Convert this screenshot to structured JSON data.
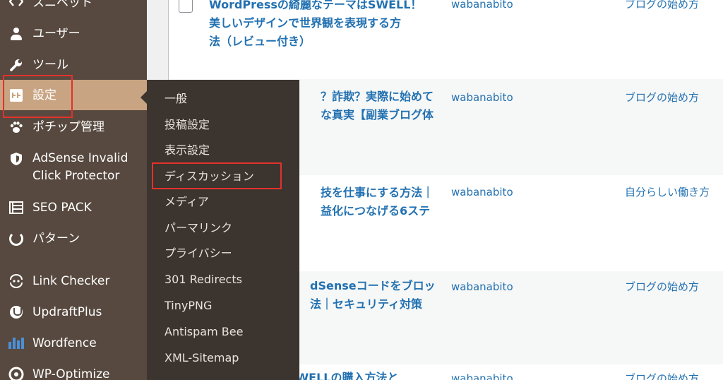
{
  "sidebar": {
    "items": [
      {
        "label": "スニペット",
        "icon": "snippet-icon"
      },
      {
        "label": "ユーザー",
        "icon": "user-icon"
      },
      {
        "label": "ツール",
        "icon": "wrench-icon"
      },
      {
        "label": "設定",
        "icon": "settings-icon",
        "active": true
      },
      {
        "label": "ポチップ管理",
        "icon": "paw-icon"
      },
      {
        "label": "AdSense Invalid Click Protector",
        "line1": "AdSense Invalid",
        "line2": "Click Protector",
        "icon": "shield-icon"
      },
      {
        "label": "SEO PACK",
        "icon": "list-icon"
      },
      {
        "label": "パターン",
        "icon": "pattern-icon"
      },
      {
        "label": "Link Checker",
        "icon": "link-checker-icon"
      },
      {
        "label": "UpdraftPlus",
        "icon": "updraftplus-icon"
      },
      {
        "label": "Wordfence",
        "icon": "wordfence-icon"
      },
      {
        "label": "WP-Optimize",
        "icon": "wp-optimize-icon"
      }
    ]
  },
  "submenu": {
    "items": [
      {
        "label": "一般"
      },
      {
        "label": "投稿設定"
      },
      {
        "label": "表示設定"
      },
      {
        "label": "ディスカッション",
        "highlighted": true
      },
      {
        "label": "メディア"
      },
      {
        "label": "パーマリンク"
      },
      {
        "label": "プライバシー"
      },
      {
        "label": "301 Redirects"
      },
      {
        "label": "TinyPNG"
      },
      {
        "label": "Antispam Bee"
      },
      {
        "label": "XML-Sitemap"
      }
    ]
  },
  "posts": {
    "rows": [
      {
        "title_line1": "WordPressの綺麗なテーマはSWELL！",
        "title_line2": "美しいデザインで世界観を表現する方",
        "title_line3": "法（レビュー付き）",
        "author": "wabanabito",
        "category": "ブログの始め方"
      },
      {
        "title_line1": "？詐欺？実際に始めて",
        "title_line2": "な真実【副業ブログ体",
        "author": "wabanabito",
        "category": "ブログの始め方"
      },
      {
        "title_line1": "技を仕事にする方法｜",
        "title_line2": "益化につなげる6ステ",
        "author": "wabanabito",
        "category": "自分らしい働き方"
      },
      {
        "title_line1": "dSenseコードをブロッ",
        "title_line2": "法｜セキュリティ対策",
        "author": "wabanabito",
        "category": "ブログの始め方"
      },
      {
        "title_line1": "【初心者向け】SWELLの購入方法と",
        "author": "wabanabito",
        "category": "ブログの始め方"
      }
    ]
  },
  "colors": {
    "sidebar_bg": "#57493f",
    "sidebar_active": "#c9a482",
    "submenu_bg": "#3c342f",
    "link": "#2271b1",
    "highlight": "#e4312b"
  }
}
